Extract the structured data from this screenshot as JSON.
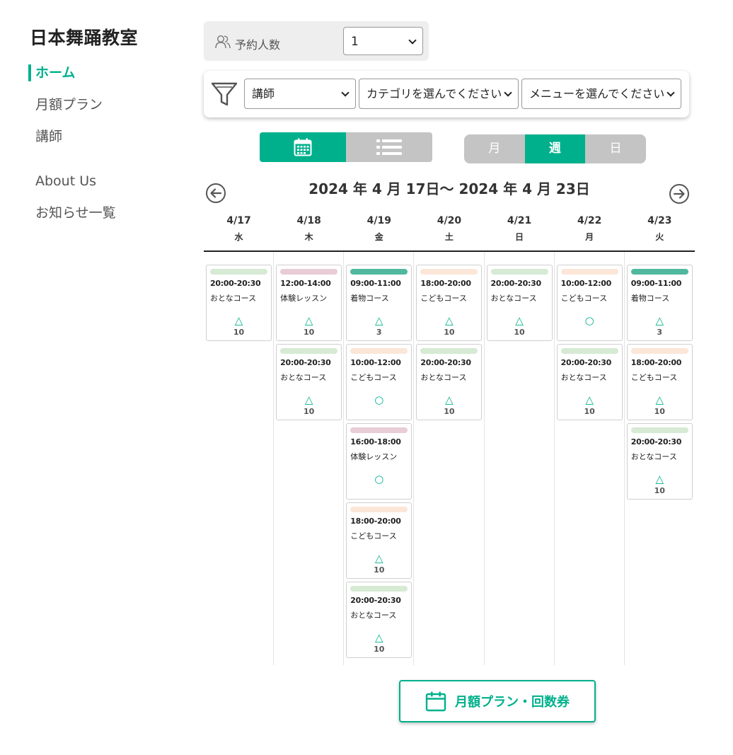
{
  "brand": "日本舞踊教室",
  "nav": {
    "items": [
      {
        "label": "ホーム",
        "active": true
      },
      {
        "label": "月額プラン",
        "active": false
      },
      {
        "label": "講師",
        "active": false
      },
      {
        "label": "About Us",
        "active": false
      },
      {
        "label": "お知らせ一覧",
        "active": false
      }
    ]
  },
  "reservation": {
    "label": "予約人数",
    "value": "1"
  },
  "filters": {
    "teacher": "講師",
    "category": "カテゴリを選んでください",
    "menu": "メニューを選んでください"
  },
  "view_toggle": {
    "active": "calendar-view"
  },
  "period": {
    "month": "月",
    "week": "週",
    "day": "日",
    "active": "週"
  },
  "range_title": "2024 年 4 月 17日〜 2024 年 4 月 23日",
  "colors": {
    "accent": "#00b08c",
    "bar_adult": "#d6ead4",
    "bar_trial": "#e8ccd6",
    "bar_kimono": "#4fb89e",
    "bar_kids": "#fbe6d8"
  },
  "days": [
    {
      "date": "4/17",
      "weekday": "水"
    },
    {
      "date": "4/18",
      "weekday": "木"
    },
    {
      "date": "4/19",
      "weekday": "金"
    },
    {
      "date": "4/20",
      "weekday": "土"
    },
    {
      "date": "4/21",
      "weekday": "日"
    },
    {
      "date": "4/22",
      "weekday": "月"
    },
    {
      "date": "4/23",
      "weekday": "火"
    }
  ],
  "schedule": [
    [
      {
        "time": "20:00-20:30",
        "name": "おとなコース",
        "bar": "adult",
        "mark": "△",
        "count": "10"
      }
    ],
    [
      {
        "time": "12:00-14:00",
        "name": "体験レッスン",
        "bar": "trial",
        "mark": "△",
        "count": "10"
      },
      {
        "time": "20:00-20:30",
        "name": "おとなコース",
        "bar": "adult",
        "mark": "△",
        "count": "10"
      }
    ],
    [
      {
        "time": "09:00-11:00",
        "name": "着物コース",
        "bar": "kimono",
        "mark": "△",
        "count": "3"
      },
      {
        "time": "10:00-12:00",
        "name": "こどもコース",
        "bar": "kids",
        "mark": "○",
        "count": ""
      },
      {
        "time": "16:00-18:00",
        "name": "体験レッスン",
        "bar": "trial",
        "mark": "○",
        "count": ""
      },
      {
        "time": "18:00-20:00",
        "name": "こどもコース",
        "bar": "kids",
        "mark": "△",
        "count": "10"
      },
      {
        "time": "20:00-20:30",
        "name": "おとなコース",
        "bar": "adult",
        "mark": "△",
        "count": "10"
      }
    ],
    [
      {
        "time": "18:00-20:00",
        "name": "こどもコース",
        "bar": "kids",
        "mark": "△",
        "count": "10"
      },
      {
        "time": "20:00-20:30",
        "name": "おとなコース",
        "bar": "adult",
        "mark": "△",
        "count": "10"
      }
    ],
    [
      {
        "time": "20:00-20:30",
        "name": "おとなコース",
        "bar": "adult",
        "mark": "△",
        "count": "10"
      }
    ],
    [
      {
        "time": "10:00-12:00",
        "name": "こどもコース",
        "bar": "kids",
        "mark": "○",
        "count": ""
      },
      {
        "time": "20:00-20:30",
        "name": "おとなコース",
        "bar": "adult",
        "mark": "△",
        "count": "10"
      }
    ],
    [
      {
        "time": "09:00-11:00",
        "name": "着物コース",
        "bar": "kimono",
        "mark": "△",
        "count": "3"
      },
      {
        "time": "18:00-20:00",
        "name": "こどもコース",
        "bar": "kids",
        "mark": "△",
        "count": "10"
      },
      {
        "time": "20:00-20:30",
        "name": "おとなコース",
        "bar": "adult",
        "mark": "△",
        "count": "10"
      }
    ]
  ],
  "cta": {
    "label": "月額プラン・回数券"
  }
}
